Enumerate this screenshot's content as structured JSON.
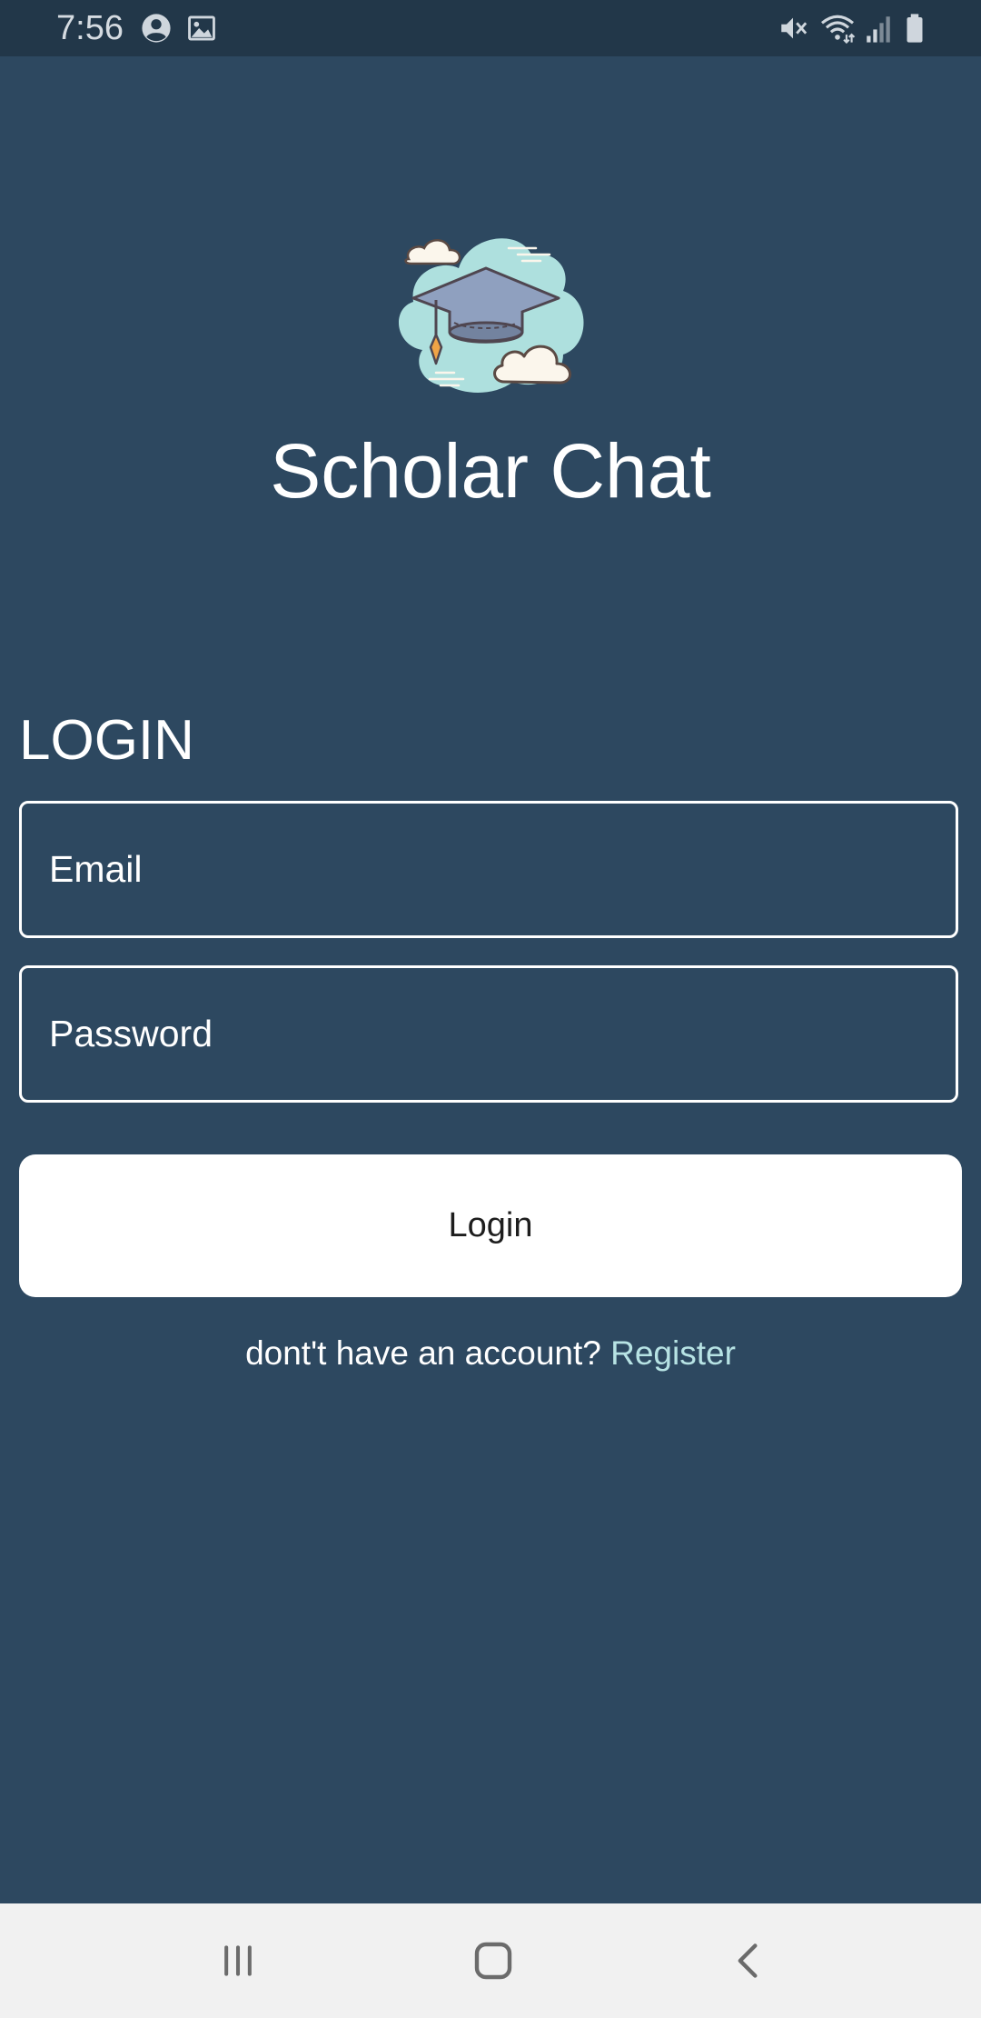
{
  "status_bar": {
    "time": "7:56",
    "left_icons": [
      "account-circle-icon",
      "image-icon"
    ],
    "right_icons": [
      "mute-vibrate-icon",
      "wifi-icon",
      "signal-icon",
      "battery-icon"
    ]
  },
  "app": {
    "logo_icon": "graduation-cap-cloud-icon",
    "title": "Scholar Chat"
  },
  "login": {
    "heading": "LOGIN",
    "email_placeholder": "Email",
    "password_placeholder": "Password",
    "button_label": "Login",
    "register_prompt": "dont't have an account? ",
    "register_link": "Register"
  },
  "nav_bar": {
    "icons": [
      "recent-apps-icon",
      "home-icon",
      "back-icon"
    ]
  },
  "colors": {
    "background": "#2d4860",
    "status_bar": "#223749",
    "link": "#b7e3e4",
    "nav_bar": "#f1f1f1"
  }
}
